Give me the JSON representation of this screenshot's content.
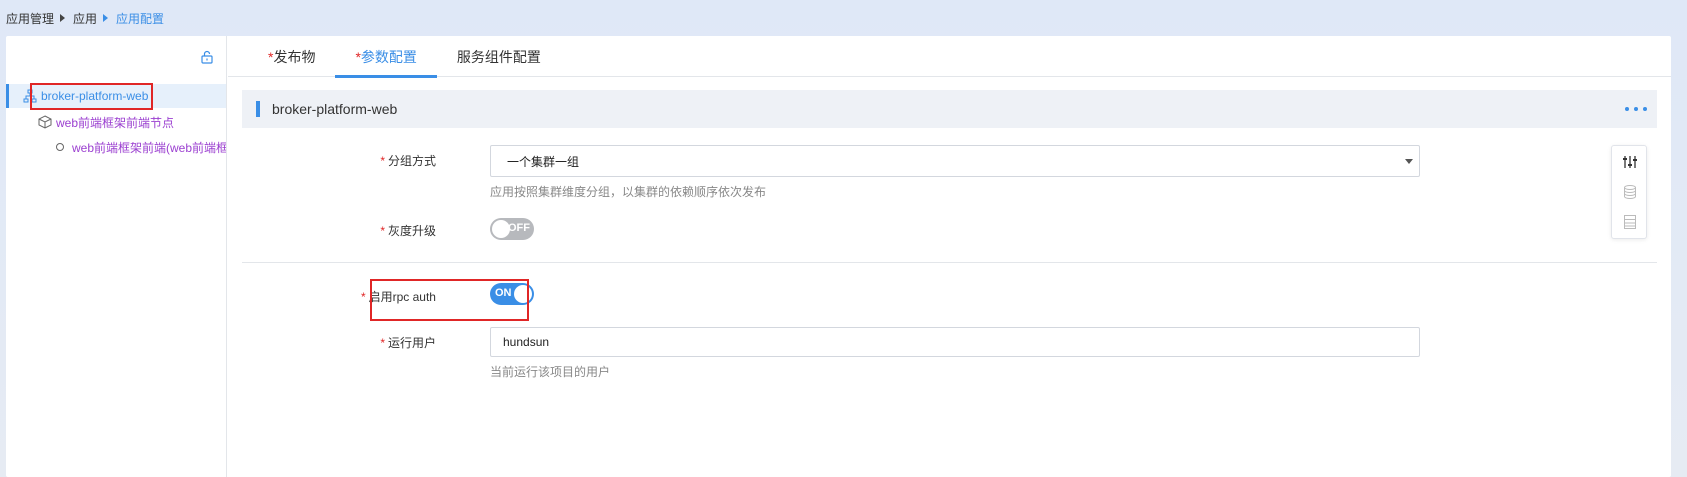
{
  "breadcrumb": {
    "items": [
      "应用管理",
      "应用"
    ],
    "current": "应用配置"
  },
  "sidebar": {
    "root": {
      "label": "broker-platform-web",
      "icon": "sitemap-icon"
    },
    "child": {
      "label": "web前端框架前端节点",
      "icon": "cube-icon"
    },
    "leaf": {
      "label": "web前端框架前端(web前端框"
    },
    "lock_icon": "unlock-icon"
  },
  "tabs": [
    {
      "label": "发布物",
      "required": "*"
    },
    {
      "label": "参数配置",
      "required": "*",
      "active": true
    },
    {
      "label": "服务组件配置",
      "required": ""
    }
  ],
  "section": {
    "title": "broker-platform-web",
    "more_icon": "more-dots-icon"
  },
  "form": {
    "required_mark": "*",
    "group_mode": {
      "label": "分组方式",
      "value": "一个集群一组",
      "hint": "应用按照集群维度分组，以集群的依赖顺序依次发布"
    },
    "gray_upgrade": {
      "label": "灰度升级",
      "state": "OFF"
    },
    "rpc_auth": {
      "label": "启用rpc auth",
      "state": "ON"
    },
    "run_user": {
      "label": "运行用户",
      "value": "hundsun",
      "hint": "当前运行该项目的用户"
    }
  },
  "float_tools": [
    "sliders-icon",
    "database-icon",
    "list-icon"
  ],
  "colors": {
    "accent": "#3a8ee6",
    "required": "#e02626",
    "tree_child": "#9b3fd0",
    "highlight": "#e02626"
  }
}
